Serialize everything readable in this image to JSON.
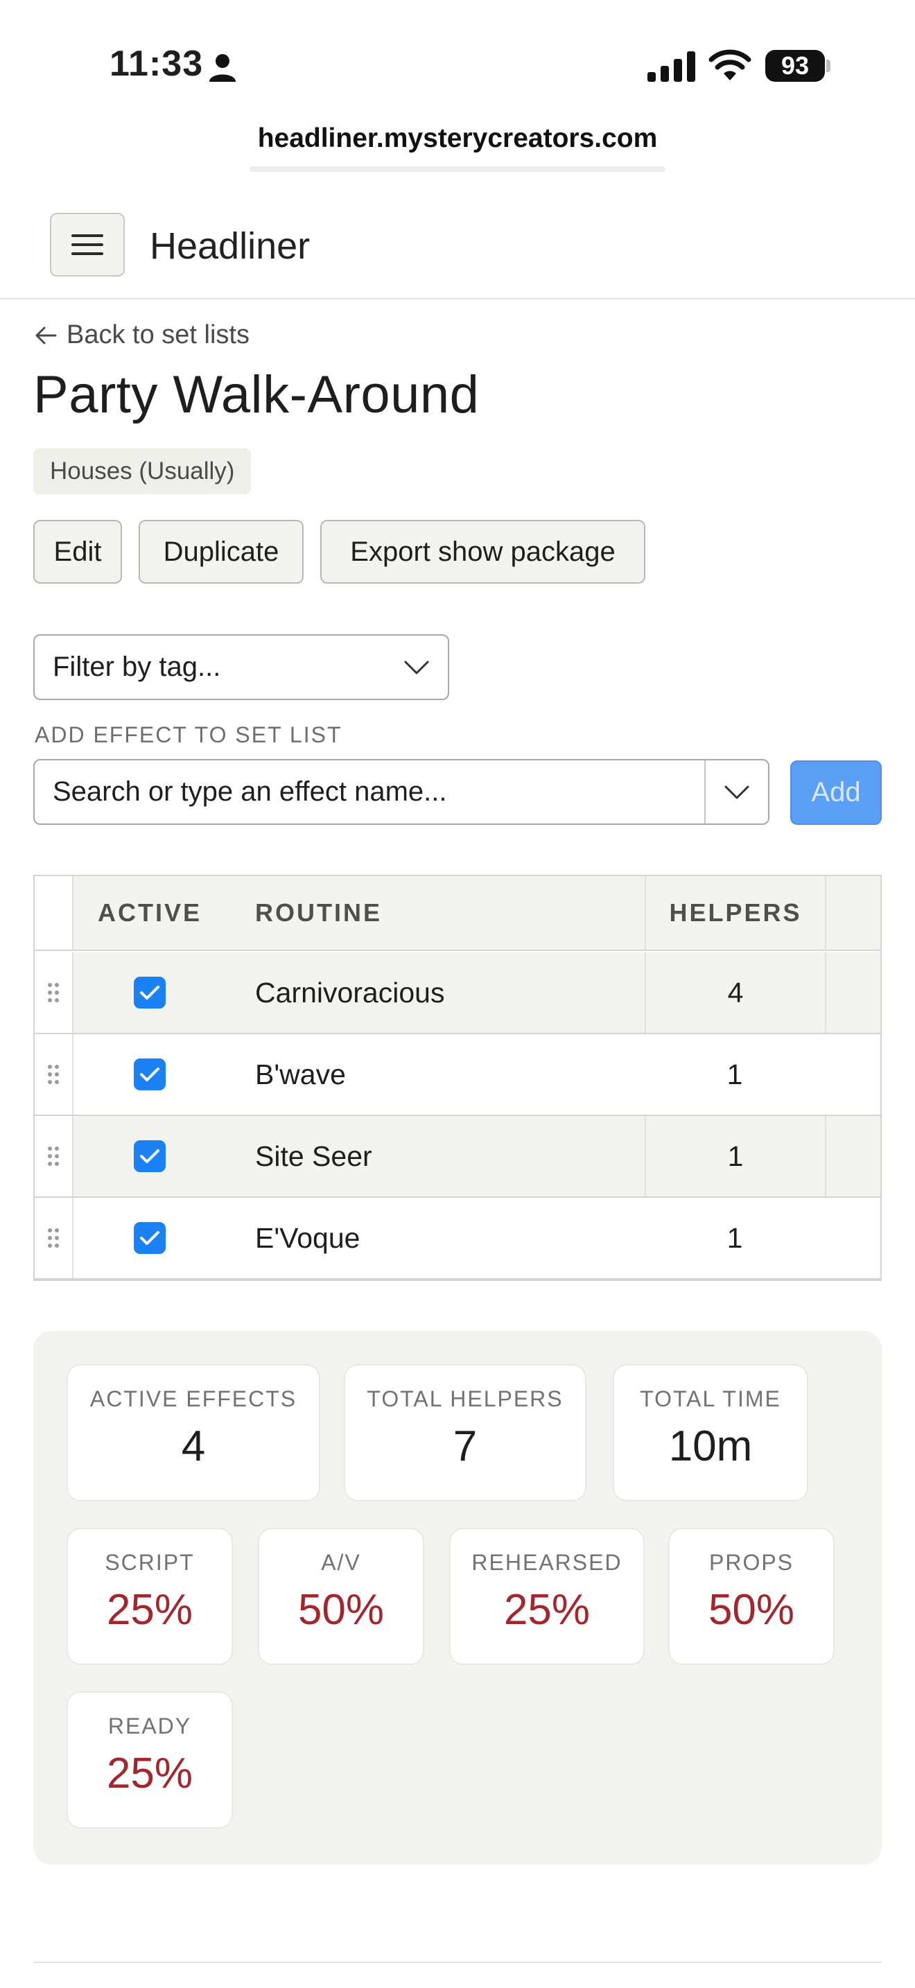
{
  "status_bar": {
    "time": "11:33",
    "battery": "93"
  },
  "browser": {
    "url": "headliner.mysterycreators.com"
  },
  "app": {
    "title": "Headliner"
  },
  "page": {
    "back_link": "Back to set lists",
    "title": "Party Walk-Around",
    "tag": "Houses (Usually)",
    "buttons": {
      "edit": "Edit",
      "duplicate": "Duplicate",
      "export": "Export show package"
    }
  },
  "filter": {
    "placeholder": "Filter by tag..."
  },
  "add_effect": {
    "label": "ADD EFFECT TO SET LIST",
    "placeholder": "Search or type an effect name...",
    "button": "Add"
  },
  "table": {
    "headers": {
      "active": "ACTIVE",
      "routine": "ROUTINE",
      "helpers": "HELPERS"
    },
    "rows": [
      {
        "active": true,
        "routine": "Carnivoracious",
        "helpers": "4"
      },
      {
        "active": true,
        "routine": "B'wave",
        "helpers": "1"
      },
      {
        "active": true,
        "routine": "Site Seer",
        "helpers": "1"
      },
      {
        "active": true,
        "routine": "E'Voque",
        "helpers": "1"
      }
    ]
  },
  "stats": {
    "active_effects": {
      "label": "ACTIVE EFFECTS",
      "value": "4"
    },
    "total_helpers": {
      "label": "TOTAL HELPERS",
      "value": "7"
    },
    "total_time": {
      "label": "TOTAL TIME",
      "value": "10m"
    },
    "script": {
      "label": "SCRIPT",
      "value": "25%"
    },
    "av": {
      "label": "A/V",
      "value": "50%"
    },
    "rehearsed": {
      "label": "REHEARSED",
      "value": "25%"
    },
    "props": {
      "label": "PROPS",
      "value": "50%"
    },
    "ready": {
      "label": "READY",
      "value": "25%"
    }
  },
  "colors": {
    "accent_blue": "#1a82f5",
    "add_button": "#5b9ff5",
    "percent_red": "#a4262c",
    "panel_bg": "#f3f3ef"
  }
}
